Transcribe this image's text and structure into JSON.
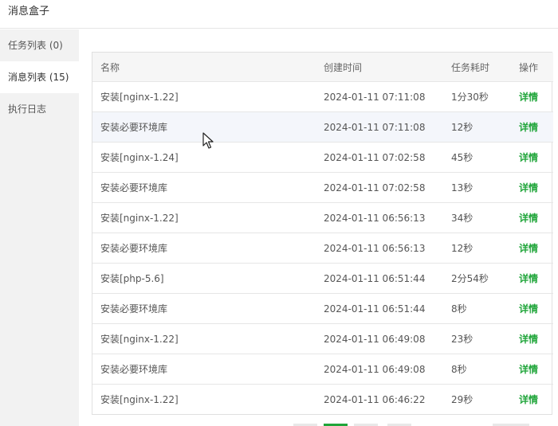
{
  "window": {
    "title": "消息盒子"
  },
  "sidebar": {
    "items": [
      {
        "label": "任务列表 (0)"
      },
      {
        "label": "消息列表 (15)"
      },
      {
        "label": "执行日志"
      }
    ]
  },
  "table": {
    "headers": [
      "名称",
      "创建时间",
      "任务耗时",
      "操作"
    ],
    "rows": [
      {
        "name": "安装[nginx-1.22]",
        "time": "2024-01-11 07:11:08",
        "duration": "1分30秒",
        "action": "详情"
      },
      {
        "name": "安装必要环境库",
        "time": "2024-01-11 07:11:08",
        "duration": "12秒",
        "action": "详情"
      },
      {
        "name": "安装[nginx-1.24]",
        "time": "2024-01-11 07:02:58",
        "duration": "45秒",
        "action": "详情"
      },
      {
        "name": "安装必要环境库",
        "time": "2024-01-11 07:02:58",
        "duration": "13秒",
        "action": "详情"
      },
      {
        "name": "安装[nginx-1.22]",
        "time": "2024-01-11 06:56:13",
        "duration": "34秒",
        "action": "详情"
      },
      {
        "name": "安装必要环境库",
        "time": "2024-01-11 06:56:13",
        "duration": "12秒",
        "action": "详情"
      },
      {
        "name": "安装[php-5.6]",
        "time": "2024-01-11 06:51:44",
        "duration": "2分54秒",
        "action": "详情"
      },
      {
        "name": "安装必要环境库",
        "time": "2024-01-11 06:51:44",
        "duration": "8秒",
        "action": "详情"
      },
      {
        "name": "安装[nginx-1.22]",
        "time": "2024-01-11 06:49:08",
        "duration": "23秒",
        "action": "详情"
      },
      {
        "name": "安装必要环境库",
        "time": "2024-01-11 06:49:08",
        "duration": "8秒",
        "action": "详情"
      },
      {
        "name": "安装[nginx-1.22]",
        "time": "2024-01-11 06:46:22",
        "duration": "29秒",
        "action": "详情"
      }
    ]
  },
  "colors": {
    "accent": "#20a53a",
    "sidebar_bg": "#f2f2f2",
    "header_bg": "#f6f6f6",
    "hover_row_bg": "#f4f6fb"
  }
}
